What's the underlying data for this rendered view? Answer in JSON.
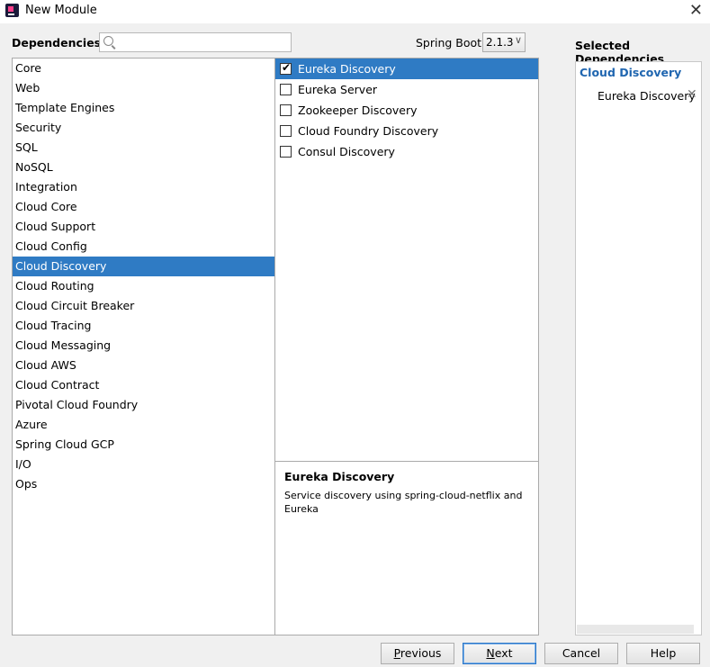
{
  "window": {
    "title": "New Module",
    "close_glyph": "✕"
  },
  "dependencies": {
    "label": "Dependencies",
    "search": {
      "value": "",
      "placeholder": ""
    }
  },
  "spring_boot": {
    "label": "Spring Boot",
    "selected": "2.1.3"
  },
  "categories": [
    "Core",
    "Web",
    "Template Engines",
    "Security",
    "SQL",
    "NoSQL",
    "Integration",
    "Cloud Core",
    "Cloud Support",
    "Cloud Config",
    "Cloud Discovery",
    "Cloud Routing",
    "Cloud Circuit Breaker",
    "Cloud Tracing",
    "Cloud Messaging",
    "Cloud AWS",
    "Cloud Contract",
    "Pivotal Cloud Foundry",
    "Azure",
    "Spring Cloud GCP",
    "I/O",
    "Ops"
  ],
  "selected_category_index": 10,
  "items": [
    {
      "label": "Eureka Discovery",
      "checked": true,
      "selected": true
    },
    {
      "label": "Eureka Server",
      "checked": false,
      "selected": false
    },
    {
      "label": "Zookeeper Discovery",
      "checked": false,
      "selected": false
    },
    {
      "label": "Cloud Foundry Discovery",
      "checked": false,
      "selected": false
    },
    {
      "label": "Consul Discovery",
      "checked": false,
      "selected": false
    }
  ],
  "description": {
    "title": "Eureka Discovery",
    "text": "Service discovery using spring-cloud-netflix and Eureka"
  },
  "selected_dependencies": {
    "title": "Selected Dependencies",
    "group": "Cloud Discovery",
    "items": [
      "Eureka Discovery"
    ],
    "remove_glyph": "✕"
  },
  "buttons": {
    "previous": {
      "mnemonic": "P",
      "rest": "revious"
    },
    "next": {
      "mnemonic": "N",
      "rest": "ext"
    },
    "cancel": "Cancel",
    "help": "Help"
  },
  "colors": {
    "selection": "#2f7bc4",
    "group_header": "#2066b0"
  }
}
